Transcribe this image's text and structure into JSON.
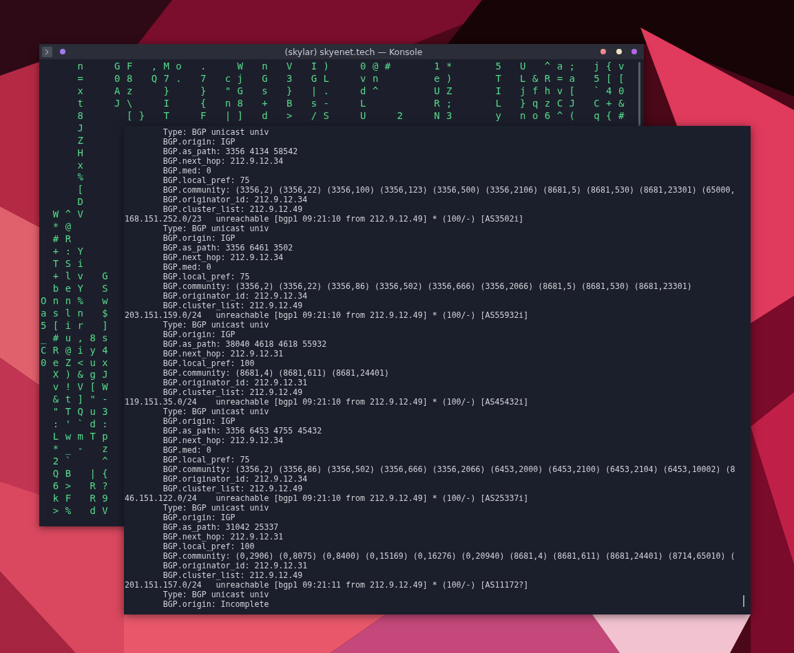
{
  "matrix_window": {
    "title": "(skylar) skyenet.tech — Konsole",
    "rows": [
      "   n  GF ,Mo .  W n V I)  0@#   1*   5 U ^a; j{v",
      "   =  08 Q7. 7 cj G 3 GL  vn    e)   T L&R=a 5[[",
      "   x  Az  }  } \"G s } |.  d^    UZ   I jfhv[ `40",
      "   t  J\\  I  { n8 + B s-  L     R;   L }qzCJ C+&",
      "   8   [} T  F |] d > /S  U  2  N3   y no6^( q{#",
      "   J",
      "   Z",
      "   H",
      "   x",
      "   %",
      "   [",
      "   D",
      " W^V",
      " *@",
      " #R",
      " +:Y",
      " TSi",
      " +lv G",
      " beY S",
      "Onn% w",
      "asln $",
      "5[ir ]",
      "_#u,8s",
      "CR@iy4",
      "0eZ<ux",
      " X)&gJ",
      " v!V[W",
      " &t]\"-",
      " \"TQu3",
      " :'`d:",
      " LwmTp",
      " *_- z",
      " 2`  ^",
      " QB |{",
      " 6> R?",
      " kF R9",
      " >% dV"
    ]
  },
  "bgp_window": {
    "lines": [
      {
        "kind": "attr",
        "text": "Type: BGP unicast univ"
      },
      {
        "kind": "attr",
        "text": "BGP.origin: IGP"
      },
      {
        "kind": "attr",
        "text": "BGP.as_path: 3356 4134 58542"
      },
      {
        "kind": "attr",
        "text": "BGP.next_hop: 212.9.12.34"
      },
      {
        "kind": "attr",
        "text": "BGP.med: 0"
      },
      {
        "kind": "attr",
        "text": "BGP.local_pref: 75"
      },
      {
        "kind": "attr",
        "text": "BGP.community: (3356,2) (3356,22) (3356,100) (3356,123) (3356,500) (3356,2106) (8681,5) (8681,530) (8681,23301) (65000,"
      },
      {
        "kind": "attr",
        "text": "BGP.originator_id: 212.9.12.34"
      },
      {
        "kind": "attr",
        "text": "BGP.cluster_list: 212.9.12.49"
      },
      {
        "kind": "route",
        "text": "168.151.252.0/23   unreachable [bgp1 09:21:10 from 212.9.12.49] * (100/-) [AS3502i]"
      },
      {
        "kind": "attr",
        "text": "Type: BGP unicast univ"
      },
      {
        "kind": "attr",
        "text": "BGP.origin: IGP"
      },
      {
        "kind": "attr",
        "text": "BGP.as_path: 3356 6461 3502"
      },
      {
        "kind": "attr",
        "text": "BGP.next_hop: 212.9.12.34"
      },
      {
        "kind": "attr",
        "text": "BGP.med: 0"
      },
      {
        "kind": "attr",
        "text": "BGP.local_pref: 75"
      },
      {
        "kind": "attr",
        "text": "BGP.community: (3356,2) (3356,22) (3356,86) (3356,502) (3356,666) (3356,2066) (8681,5) (8681,530) (8681,23301)"
      },
      {
        "kind": "attr",
        "text": "BGP.originator_id: 212.9.12.34"
      },
      {
        "kind": "attr",
        "text": "BGP.cluster_list: 212.9.12.49"
      },
      {
        "kind": "route",
        "text": "203.151.159.0/24   unreachable [bgp1 09:21:10 from 212.9.12.49] * (100/-) [AS55932i]"
      },
      {
        "kind": "attr",
        "text": "Type: BGP unicast univ"
      },
      {
        "kind": "attr",
        "text": "BGP.origin: IGP"
      },
      {
        "kind": "attr",
        "text": "BGP.as_path: 38040 4618 4618 55932"
      },
      {
        "kind": "attr",
        "text": "BGP.next_hop: 212.9.12.31"
      },
      {
        "kind": "attr",
        "text": "BGP.local_pref: 100"
      },
      {
        "kind": "attr",
        "text": "BGP.community: (8681,4) (8681,611) (8681,24401)"
      },
      {
        "kind": "attr",
        "text": "BGP.originator_id: 212.9.12.31"
      },
      {
        "kind": "attr",
        "text": "BGP.cluster_list: 212.9.12.49"
      },
      {
        "kind": "route",
        "text": "119.151.35.0/24    unreachable [bgp1 09:21:10 from 212.9.12.49] * (100/-) [AS45432i]"
      },
      {
        "kind": "attr",
        "text": "Type: BGP unicast univ"
      },
      {
        "kind": "attr",
        "text": "BGP.origin: IGP"
      },
      {
        "kind": "attr",
        "text": "BGP.as_path: 3356 6453 4755 45432"
      },
      {
        "kind": "attr",
        "text": "BGP.next_hop: 212.9.12.34"
      },
      {
        "kind": "attr",
        "text": "BGP.med: 0"
      },
      {
        "kind": "attr",
        "text": "BGP.local_pref: 75"
      },
      {
        "kind": "attr",
        "text": "BGP.community: (3356,2) (3356,86) (3356,502) (3356,666) (3356,2066) (6453,2000) (6453,2100) (6453,2104) (6453,10002) (8"
      },
      {
        "kind": "attr",
        "text": "BGP.originator_id: 212.9.12.34"
      },
      {
        "kind": "attr",
        "text": "BGP.cluster_list: 212.9.12.49"
      },
      {
        "kind": "route",
        "text": "46.151.122.0/24    unreachable [bgp1 09:21:10 from 212.9.12.49] * (100/-) [AS25337i]"
      },
      {
        "kind": "attr",
        "text": "Type: BGP unicast univ"
      },
      {
        "kind": "attr",
        "text": "BGP.origin: IGP"
      },
      {
        "kind": "attr",
        "text": "BGP.as_path: 31042 25337"
      },
      {
        "kind": "attr",
        "text": "BGP.next_hop: 212.9.12.31"
      },
      {
        "kind": "attr",
        "text": "BGP.local_pref: 100"
      },
      {
        "kind": "attr",
        "text": "BGP.community: (0,2906) (0,8075) (0,8400) (0,15169) (0,16276) (0,20940) (8681,4) (8681,611) (8681,24401) (8714,65010) ("
      },
      {
        "kind": "attr",
        "text": "BGP.originator_id: 212.9.12.31"
      },
      {
        "kind": "attr",
        "text": "BGP.cluster_list: 212.9.12.49"
      },
      {
        "kind": "route",
        "text": "201.151.157.0/24   unreachable [bgp1 09:21:11 from 212.9.12.49] * (100/-) [AS11172?]"
      },
      {
        "kind": "attr",
        "text": "Type: BGP unicast univ"
      },
      {
        "kind": "attr",
        "text": "BGP.origin: Incomplete"
      }
    ]
  }
}
